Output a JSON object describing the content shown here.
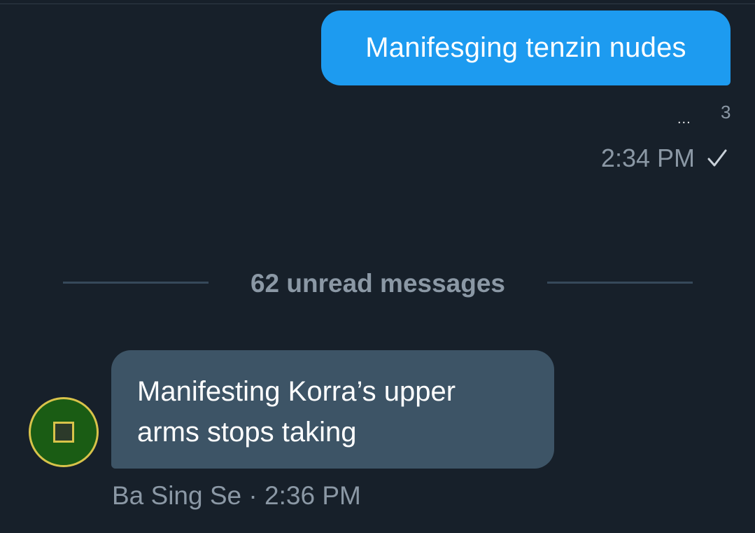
{
  "sent_message": {
    "text": "Manifesging tenzin nudes",
    "typing_indicator": "...",
    "reaction_count": "3",
    "time": "2:34 PM",
    "status_icon": "check-icon",
    "bubble_color": "#1d9bf0"
  },
  "unread_divider": {
    "label": "62 unread messages"
  },
  "received_message": {
    "text": "Manifesting Korra’s upper arms stops taking",
    "sender": "Ba Sing Se",
    "separator": " · ",
    "time": "2:36 PM",
    "bubble_color": "#3d5466",
    "avatar_icon": "earth-kingdom-emblem-icon"
  },
  "theme": {
    "background": "#17202a",
    "secondary_text": "#8b98a5",
    "divider": "#36495a"
  }
}
